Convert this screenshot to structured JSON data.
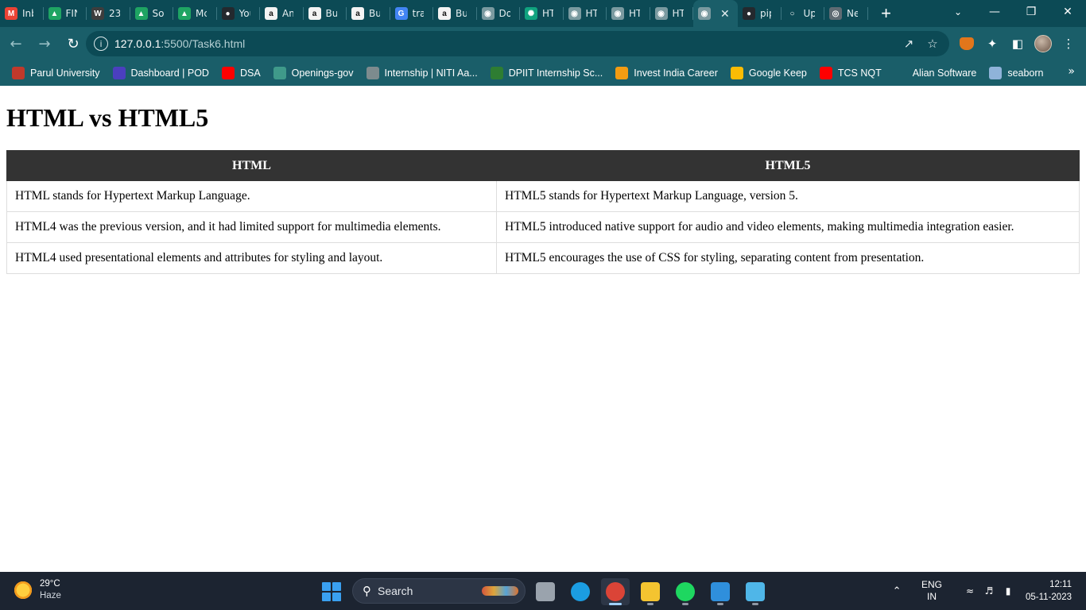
{
  "browser": {
    "tabs": [
      {
        "title": "Inbox",
        "icon": "gmail-icon",
        "color": "#ea4335",
        "glyph": "M"
      },
      {
        "title": "FIN",
        "icon": "google-drive-icon",
        "color": "#1fa463",
        "glyph": "▲"
      },
      {
        "title": "23",
        "icon": "wordpress-icon",
        "color": "#3d3d3d",
        "glyph": "W"
      },
      {
        "title": "Sol",
        "icon": "google-drive-icon",
        "color": "#1fa463",
        "glyph": "▲"
      },
      {
        "title": "Mc",
        "icon": "google-drive-icon",
        "color": "#1fa463",
        "glyph": "▲"
      },
      {
        "title": "You",
        "icon": "github-icon",
        "color": "#24292e",
        "glyph": "●"
      },
      {
        "title": "Am",
        "icon": "amazon-icon",
        "color": "#f3f3f3",
        "glyph": "a"
      },
      {
        "title": "Bu",
        "icon": "amazon-icon",
        "color": "#f3f3f3",
        "glyph": "a"
      },
      {
        "title": "Bu",
        "icon": "amazon-icon",
        "color": "#f3f3f3",
        "glyph": "a"
      },
      {
        "title": "tra",
        "icon": "google-icon",
        "color": "#4285f4",
        "glyph": "G"
      },
      {
        "title": "Bu",
        "icon": "amazon-icon",
        "color": "#f3f3f3",
        "glyph": "a"
      },
      {
        "title": "Do",
        "icon": "globe-icon",
        "color": "#7a9aa0",
        "glyph": "◉"
      },
      {
        "title": "HT",
        "icon": "chatgpt-icon",
        "color": "#10a37f",
        "glyph": "✺"
      },
      {
        "title": "HT",
        "icon": "globe-icon",
        "color": "#7a9aa0",
        "glyph": "◉"
      },
      {
        "title": "HT",
        "icon": "globe-icon",
        "color": "#7a9aa0",
        "glyph": "◉"
      },
      {
        "title": "HT",
        "icon": "globe-icon",
        "color": "#7a9aa0",
        "glyph": "◉"
      },
      {
        "title": "",
        "icon": "globe-icon",
        "color": "#7a9aa0",
        "glyph": "◉",
        "active": true
      },
      {
        "title": "pip",
        "icon": "github-icon",
        "color": "#24292e",
        "glyph": "●"
      },
      {
        "title": "Up",
        "icon": "loading-icon",
        "color": "#0c4a55",
        "glyph": "○"
      },
      {
        "title": "Ne",
        "icon": "chrome-icon",
        "color": "#5f6b73",
        "glyph": "◎"
      }
    ],
    "address": {
      "host": "127.0.0.1",
      "path": ":5500/Task6.html"
    },
    "bookmarks": [
      {
        "label": "Parul University",
        "icon": "parul-icon",
        "color": "#c0392b"
      },
      {
        "label": "Dashboard | POD",
        "icon": "pod-icon",
        "color": "#4b3fbf"
      },
      {
        "label": "DSA",
        "icon": "youtube-icon",
        "color": "#ff0000"
      },
      {
        "label": "Openings-gov",
        "icon": "openings-icon",
        "color": "#3f9a8a"
      },
      {
        "label": "Internship | NITI Aa...",
        "icon": "niti-icon",
        "color": "#7d8b8e"
      },
      {
        "label": "DPIIT Internship Sc...",
        "icon": "mygov-icon",
        "color": "#2e7d32"
      },
      {
        "label": "Invest India Career",
        "icon": "invest-india-icon",
        "color": "#f39c12"
      },
      {
        "label": "Google Keep",
        "icon": "google-keep-icon",
        "color": "#fbbc04"
      },
      {
        "label": "TCS NQT",
        "icon": "youtube-icon",
        "color": "#ff0000"
      },
      {
        "label": "Alian Software",
        "icon": "alian-icon",
        "color": "#1a5e69"
      },
      {
        "label": "seaborn",
        "icon": "seaborn-icon",
        "color": "#8fb3d9"
      }
    ]
  },
  "page": {
    "heading": "HTML vs HTML5",
    "table": {
      "headers": [
        "HTML",
        "HTML5"
      ],
      "rows": [
        [
          "HTML stands for Hypertext Markup Language.",
          "HTML5 stands for Hypertext Markup Language, version 5."
        ],
        [
          "HTML4 was the previous version, and it had limited support for multimedia elements.",
          "HTML5 introduced native support for audio and video elements, making multimedia integration easier."
        ],
        [
          "HTML4 used presentational elements and attributes for styling and layout.",
          "HTML5 encourages the use of CSS for styling, separating content from presentation."
        ]
      ]
    }
  },
  "taskbar": {
    "weather": {
      "temp": "29°C",
      "condition": "Haze"
    },
    "search_label": "Search",
    "apps": [
      {
        "name": "task-view-icon",
        "color": "#9aa3ad"
      },
      {
        "name": "edge-icon",
        "color": "#1b9de2"
      },
      {
        "name": "chrome-icon",
        "color": "#db4437",
        "active": true
      },
      {
        "name": "file-explorer-icon",
        "color": "#f4c430"
      },
      {
        "name": "spotify-icon",
        "color": "#1ed760"
      },
      {
        "name": "vscode-icon",
        "color": "#2f8fdc"
      },
      {
        "name": "notepad-icon",
        "color": "#4fb6e8"
      }
    ],
    "lang": {
      "line1": "ENG",
      "line2": "IN"
    },
    "time": "12:11",
    "date": "05-11-2023"
  }
}
